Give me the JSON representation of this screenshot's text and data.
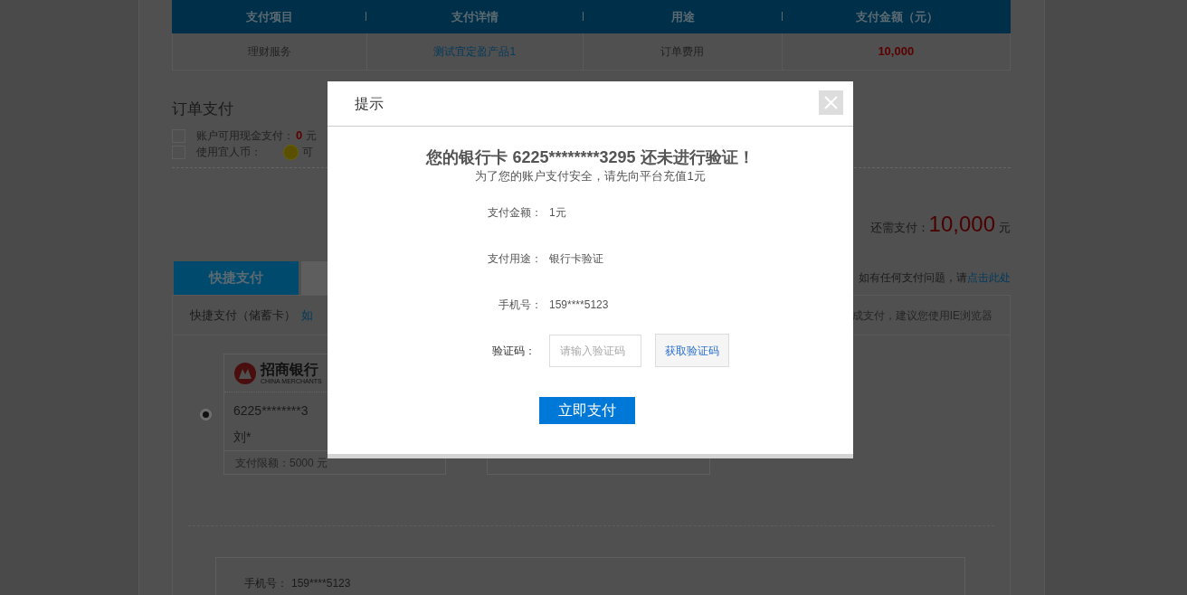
{
  "payment_table": {
    "columns": [
      "支付项目",
      "支付详情",
      "用途",
      "支付金额（元）"
    ],
    "rows": [
      {
        "item": "理财服务",
        "detail": "测试宜定盈产品1",
        "purpose": "订单费用",
        "amount": "10,000"
      }
    ]
  },
  "order_payment": {
    "title": "订单支付",
    "options": [
      {
        "kind": "cash",
        "checked": false,
        "label": "账户可用现金支付：",
        "amount": "0",
        "unit": "元"
      },
      {
        "kind": "coin",
        "checked": false,
        "label": "使用宜人币：",
        "note": "可"
      }
    ],
    "remaining_label": "还需支付：",
    "remaining_amount": "10,000",
    "remaining_unit": "元"
  },
  "pay_tabs": [
    {
      "label": "快捷支付",
      "selected": true
    },
    {
      "selected": false
    }
  ],
  "help": {
    "text": "如有任何支付问题，请",
    "link": "点击此处"
  },
  "quick_pay": {
    "title": "快捷支付（储蓄卡）",
    "link": "如",
    "browser_note": "成支付，建议您使用IE浏览器",
    "cards": [
      {
        "selected": true,
        "bank": "招商银行",
        "bank_en": "CHINA MERCHANTS",
        "number": "6225********3",
        "holder": "刘*",
        "limit": "支付限额：5000 元"
      }
    ],
    "phone_label": "手机号：",
    "phone": "159****5123"
  },
  "dialog": {
    "title": "提示",
    "headline": "您的银行卡 6225********3295 还未进行验证！",
    "subtitle": "为了您的账户支付安全，请先向平台充值1元",
    "fields": [
      {
        "label": "支付金额：",
        "value": "1元"
      },
      {
        "label": "支付用途：",
        "value": "银行卡验证"
      },
      {
        "label": "手机号：",
        "value": "159****5123"
      }
    ],
    "code": {
      "label": "验证码：",
      "placeholder": "请输入验证码",
      "button": "获取验证码"
    },
    "submit": "立即支付"
  }
}
